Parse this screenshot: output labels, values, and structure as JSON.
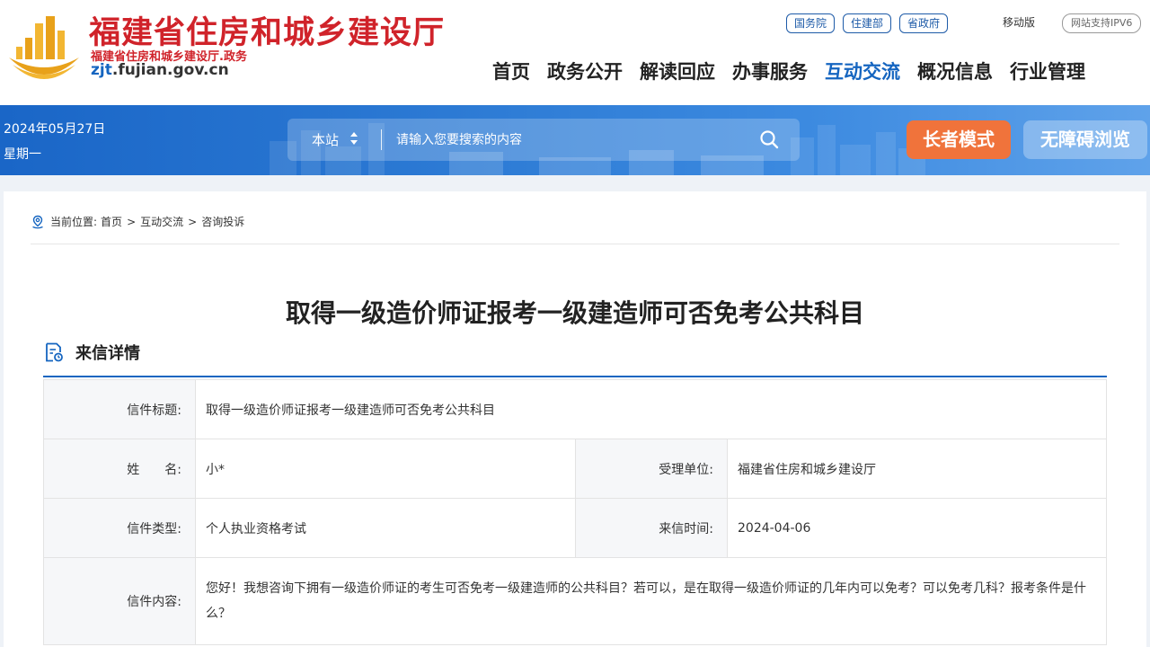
{
  "header": {
    "site_title": "福建省住房和城乡建设厅",
    "site_subtitle": "福建省住房和城乡建设厅.政务",
    "site_domain_first": "zjt",
    "site_domain_rest": ".fujian.gov.cn",
    "top_links": [
      "国务院",
      "住建部",
      "省政府"
    ],
    "mobile_label": "移动版",
    "ipv6_label": "网站支持IPV6",
    "nav": [
      "首页",
      "政务公开",
      "解读回应",
      "办事服务",
      "互动交流",
      "概况信息",
      "行业管理"
    ],
    "nav_active": "互动交流"
  },
  "banner": {
    "date": "2024年05月27日",
    "weekday": "星期一",
    "search_scope": "本站",
    "search_placeholder": "请输入您要搜索的内容",
    "elder_mode": "长者模式",
    "accessibility": "无障碍浏览"
  },
  "breadcrumb": {
    "prefix": "当前位置:",
    "items": [
      "首页",
      "互动交流",
      "咨询投诉"
    ],
    "separator": ">"
  },
  "article": {
    "title": "取得一级造价师证报考一级建造师可否免考公共科目",
    "section_label": "来信详情"
  },
  "details": {
    "subject_label": "信件标题:",
    "subject_value": "取得一级造价师证报考一级建造师可否免考公共科目",
    "name_label": "姓　　名:",
    "name_value": "小*",
    "unit_label": "受理单位:",
    "unit_value": "福建省住房和城乡建设厅",
    "type_label": "信件类型:",
    "type_value": "个人执业资格考试",
    "time_label": "来信时间:",
    "time_value": "2024-04-06",
    "content_label": "信件内容:",
    "content_value": "您好！我想咨询下拥有一级造价师证的考生可否免考一级建造师的公共科目？若可以，是在取得一级造价师证的几年内可以免考？可以免考几科？报考条件是什么？"
  },
  "colors": {
    "brand_red": "#d0232a",
    "brand_blue": "#1565c0",
    "elder_orange": "#f0733b"
  }
}
